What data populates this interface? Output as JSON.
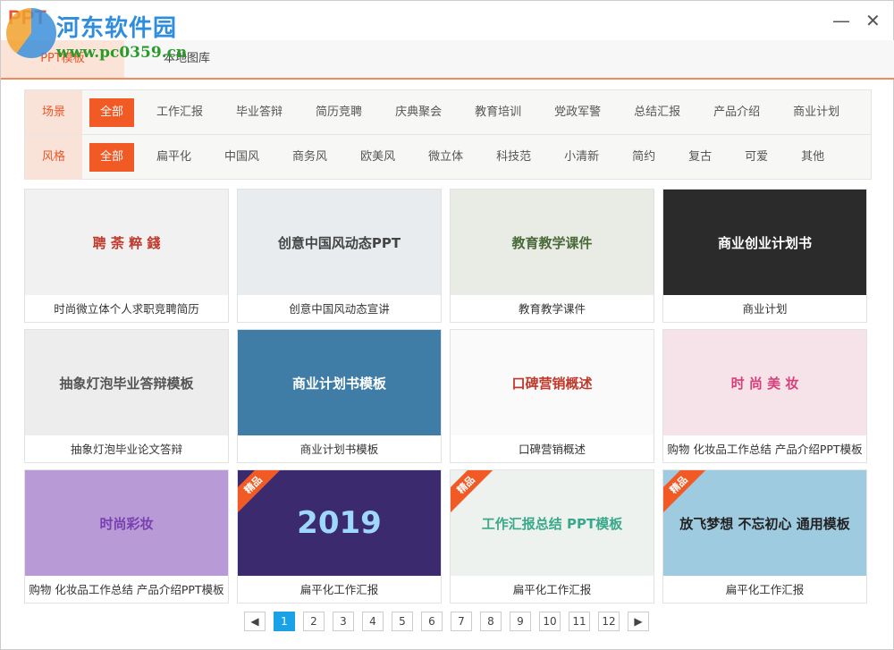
{
  "window": {
    "logo": "PPT",
    "watermark": "河东软件园",
    "watermark_url": "www.pc0359.cn",
    "minimize": "—",
    "close": "✕"
  },
  "tabs": [
    {
      "label": "PPT模板",
      "active": true
    },
    {
      "label": "本地图库",
      "active": false
    }
  ],
  "filters": {
    "scene": {
      "label": "场景",
      "items": [
        "全部",
        "工作汇报",
        "毕业答辩",
        "简历竞聘",
        "庆典聚会",
        "教育培训",
        "党政军警",
        "总结汇报",
        "产品介绍",
        "商业计划"
      ],
      "selected": "全部"
    },
    "style": {
      "label": "风格",
      "items": [
        "全部",
        "扁平化",
        "中国风",
        "商务风",
        "欧美风",
        "微立体",
        "科技范",
        "小清新",
        "简约",
        "复古",
        "可爱",
        "其他"
      ],
      "selected": "全部"
    }
  },
  "templates": [
    {
      "title": "时尚微立体个人求职竞聘简历",
      "thumb_text": "聘 荼 粹 錢",
      "bg": "#f1f1f1",
      "fg": "#c0392b"
    },
    {
      "title": "创意中国风动态宣讲",
      "thumb_text": "创意中国风动态PPT",
      "bg": "#e8ecee",
      "fg": "#444"
    },
    {
      "title": "教育教学课件",
      "thumb_text": "教育教学课件",
      "bg": "#e9ece4",
      "fg": "#4a6a3a"
    },
    {
      "title": "商业计划",
      "thumb_text": "商业创业计划书",
      "bg": "#2b2b2b",
      "fg": "#fff"
    },
    {
      "title": "抽象灯泡毕业论文答辩",
      "thumb_text": "抽象灯泡毕业答辩模板",
      "bg": "#ededed",
      "fg": "#555"
    },
    {
      "title": "商业计划书模板",
      "thumb_text": "商业计划书模板",
      "bg": "#3f7da6",
      "fg": "#fff"
    },
    {
      "title": "口碑营销概述",
      "thumb_text": "口碑营销概述",
      "bg": "#fafafa",
      "fg": "#c0392b"
    },
    {
      "title": "购物 化妆品工作总结 产品介绍PPT模板",
      "thumb_text": "时 尚 美 妆",
      "bg": "#f6e3ea",
      "fg": "#d63f7a"
    },
    {
      "title": "购物 化妆品工作总结 产品介绍PPT模板",
      "thumb_text": "时尚彩妆",
      "bg": "#b79ad6",
      "fg": "#7a3fb0"
    },
    {
      "title": "扁平化工作汇报",
      "thumb_text": "2019",
      "badge": "精品",
      "bg": "#3b2a6e",
      "fg": "#9fd8ff"
    },
    {
      "title": "扁平化工作汇报",
      "thumb_text": "工作汇报总结 PPT模板",
      "badge": "精品",
      "bg": "#eef2ee",
      "fg": "#3aa88a"
    },
    {
      "title": "扁平化工作汇报",
      "thumb_text": "放飞梦想 不忘初心 通用模板",
      "badge": "精品",
      "bg": "#9fcbe0",
      "fg": "#222"
    }
  ],
  "pagination": {
    "prev": "◀",
    "next": "▶",
    "pages": [
      "1",
      "2",
      "3",
      "4",
      "5",
      "6",
      "7",
      "8",
      "9",
      "10",
      "11",
      "12"
    ],
    "current": "1"
  }
}
